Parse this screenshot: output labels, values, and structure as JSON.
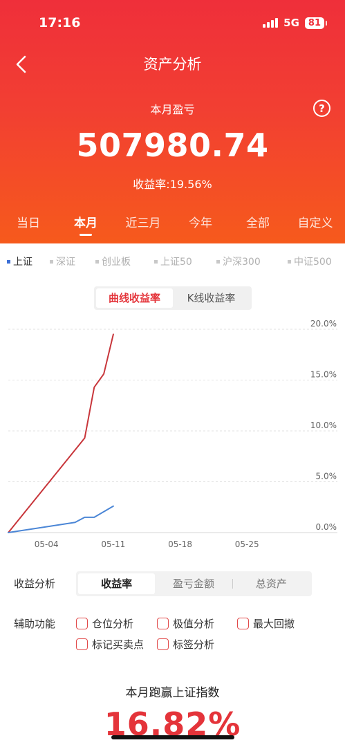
{
  "status": {
    "time": "17:16",
    "network": "5G",
    "battery": "81"
  },
  "nav": {
    "title": "资产分析"
  },
  "summary": {
    "label": "本月盈亏",
    "amount": "507980.74",
    "yield_label": "收益率:",
    "yield_value": "19.56%"
  },
  "period_tabs": [
    {
      "label": "当日"
    },
    {
      "label": "本月",
      "active": true
    },
    {
      "label": "近三月"
    },
    {
      "label": "今年"
    },
    {
      "label": "全部"
    },
    {
      "label": "自定义"
    }
  ],
  "index_filters": [
    {
      "label": "上证",
      "active": true
    },
    {
      "label": "深证"
    },
    {
      "label": "创业板"
    },
    {
      "label": "上证50"
    },
    {
      "label": "沪深300"
    },
    {
      "label": "中证500"
    }
  ],
  "chart_toggle": {
    "curve": "曲线收益率",
    "kline": "K线收益率"
  },
  "chart_data": {
    "type": "line",
    "x_ticks": [
      "05-04",
      "05-11",
      "05-18",
      "05-25"
    ],
    "y_ticks": [
      "20.0%",
      "15.0%",
      "10.0%",
      "5.0%",
      "0.0%"
    ],
    "ylim": [
      0,
      20
    ],
    "xlim": [
      "04-30",
      "05-31"
    ],
    "grid": true,
    "series": [
      {
        "color": "#c8363b",
        "points": [
          [
            "04-30",
            0
          ],
          [
            "05-08",
            9.3
          ],
          [
            "05-09",
            14.3
          ],
          [
            "05-10",
            15.6
          ],
          [
            "05-11",
            19.5
          ]
        ]
      },
      {
        "color": "#4b86d6",
        "points": [
          [
            "04-30",
            0
          ],
          [
            "05-07",
            1.0
          ],
          [
            "05-08",
            1.5
          ],
          [
            "05-09",
            1.5
          ],
          [
            "05-11",
            2.6
          ]
        ]
      }
    ]
  },
  "analysis": {
    "label": "收益分析",
    "options": [
      "收益率",
      "盈亏金额",
      "总资产"
    ],
    "active": 0
  },
  "aux": {
    "label": "辅助功能",
    "options": [
      "仓位分析",
      "极值分析",
      "最大回撤",
      "标记买卖点",
      "标签分析"
    ]
  },
  "beat": {
    "title": "本月跑赢上证指数",
    "value": "16.82%"
  },
  "colors": {
    "header_top": "#ef2f3a",
    "header_bottom": "#f65a1c",
    "accent": "#e4343a"
  }
}
